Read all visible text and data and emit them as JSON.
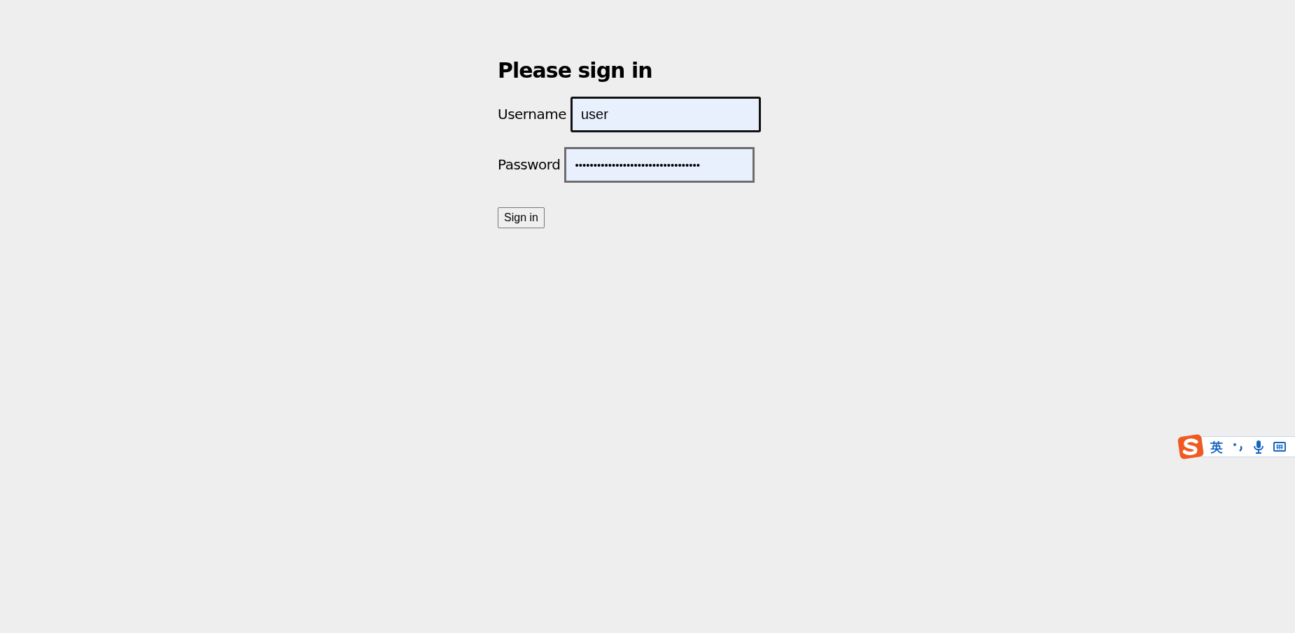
{
  "form": {
    "title": "Please sign in",
    "fields": [
      {
        "label": "Username",
        "value": "user",
        "focused": true
      },
      {
        "label": "Password",
        "value": "••••••••••••••••••••••••••••••••••",
        "focused": false
      }
    ],
    "button": "Sign in"
  },
  "ime_toolbar": {
    "mode": "英"
  }
}
